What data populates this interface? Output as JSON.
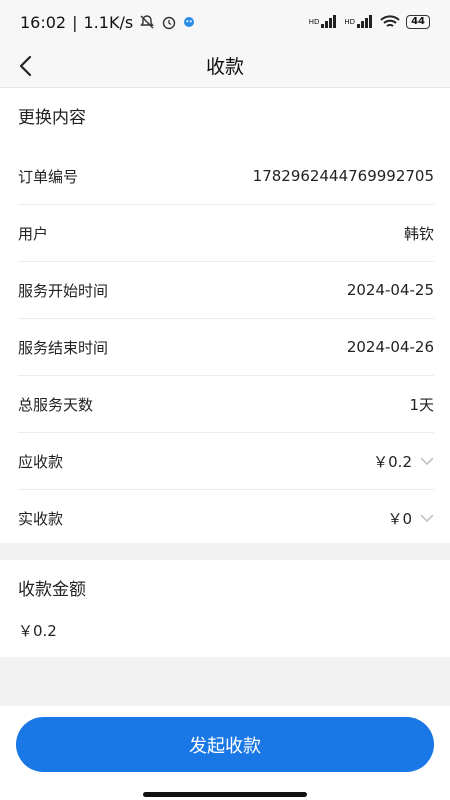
{
  "status_bar": {
    "time": "16:02",
    "network_speed": "1.1K/s",
    "battery": "44",
    "signal_label_1": "HD",
    "signal_label_2": "HD",
    "icons": [
      "bell-muted-icon",
      "alarm-icon",
      "app-notification-icon",
      "signal-icon",
      "wifi-icon",
      "battery-icon"
    ]
  },
  "nav": {
    "title": "收款",
    "back_icon": "chevron-left-icon"
  },
  "details": {
    "title": "更换内容",
    "rows": [
      {
        "label": "订单编号",
        "value": "1782962444769992705"
      },
      {
        "label": "用户",
        "value": "韩钦"
      },
      {
        "label": "服务开始时间",
        "value": "2024-04-25"
      },
      {
        "label": "服务结束时间",
        "value": "2024-04-26"
      },
      {
        "label": "总服务天数",
        "value": "1天"
      },
      {
        "label": "应收款",
        "value": "￥0.2",
        "dropdown": true
      },
      {
        "label": "实收款",
        "value": "￥0",
        "dropdown": true
      }
    ]
  },
  "payment": {
    "title": "收款金额",
    "amount": "￥0.2"
  },
  "footer": {
    "submit_label": "发起收款",
    "accent_color": "#1a78e6"
  }
}
